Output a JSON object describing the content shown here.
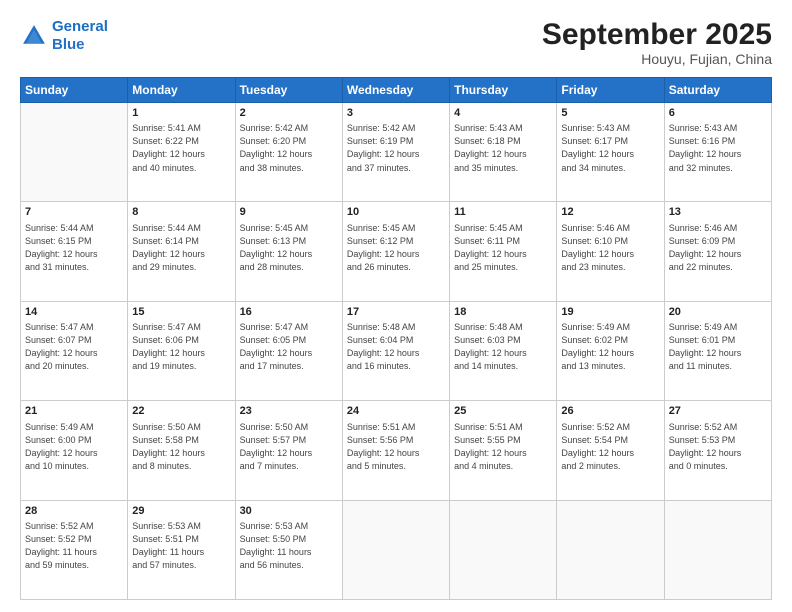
{
  "header": {
    "logo_line1": "General",
    "logo_line2": "Blue",
    "month": "September 2025",
    "location": "Houyu, Fujian, China"
  },
  "weekdays": [
    "Sunday",
    "Monday",
    "Tuesday",
    "Wednesday",
    "Thursday",
    "Friday",
    "Saturday"
  ],
  "weeks": [
    [
      {
        "day": "",
        "info": ""
      },
      {
        "day": "1",
        "info": "Sunrise: 5:41 AM\nSunset: 6:22 PM\nDaylight: 12 hours\nand 40 minutes."
      },
      {
        "day": "2",
        "info": "Sunrise: 5:42 AM\nSunset: 6:20 PM\nDaylight: 12 hours\nand 38 minutes."
      },
      {
        "day": "3",
        "info": "Sunrise: 5:42 AM\nSunset: 6:19 PM\nDaylight: 12 hours\nand 37 minutes."
      },
      {
        "day": "4",
        "info": "Sunrise: 5:43 AM\nSunset: 6:18 PM\nDaylight: 12 hours\nand 35 minutes."
      },
      {
        "day": "5",
        "info": "Sunrise: 5:43 AM\nSunset: 6:17 PM\nDaylight: 12 hours\nand 34 minutes."
      },
      {
        "day": "6",
        "info": "Sunrise: 5:43 AM\nSunset: 6:16 PM\nDaylight: 12 hours\nand 32 minutes."
      }
    ],
    [
      {
        "day": "7",
        "info": "Sunrise: 5:44 AM\nSunset: 6:15 PM\nDaylight: 12 hours\nand 31 minutes."
      },
      {
        "day": "8",
        "info": "Sunrise: 5:44 AM\nSunset: 6:14 PM\nDaylight: 12 hours\nand 29 minutes."
      },
      {
        "day": "9",
        "info": "Sunrise: 5:45 AM\nSunset: 6:13 PM\nDaylight: 12 hours\nand 28 minutes."
      },
      {
        "day": "10",
        "info": "Sunrise: 5:45 AM\nSunset: 6:12 PM\nDaylight: 12 hours\nand 26 minutes."
      },
      {
        "day": "11",
        "info": "Sunrise: 5:45 AM\nSunset: 6:11 PM\nDaylight: 12 hours\nand 25 minutes."
      },
      {
        "day": "12",
        "info": "Sunrise: 5:46 AM\nSunset: 6:10 PM\nDaylight: 12 hours\nand 23 minutes."
      },
      {
        "day": "13",
        "info": "Sunrise: 5:46 AM\nSunset: 6:09 PM\nDaylight: 12 hours\nand 22 minutes."
      }
    ],
    [
      {
        "day": "14",
        "info": "Sunrise: 5:47 AM\nSunset: 6:07 PM\nDaylight: 12 hours\nand 20 minutes."
      },
      {
        "day": "15",
        "info": "Sunrise: 5:47 AM\nSunset: 6:06 PM\nDaylight: 12 hours\nand 19 minutes."
      },
      {
        "day": "16",
        "info": "Sunrise: 5:47 AM\nSunset: 6:05 PM\nDaylight: 12 hours\nand 17 minutes."
      },
      {
        "day": "17",
        "info": "Sunrise: 5:48 AM\nSunset: 6:04 PM\nDaylight: 12 hours\nand 16 minutes."
      },
      {
        "day": "18",
        "info": "Sunrise: 5:48 AM\nSunset: 6:03 PM\nDaylight: 12 hours\nand 14 minutes."
      },
      {
        "day": "19",
        "info": "Sunrise: 5:49 AM\nSunset: 6:02 PM\nDaylight: 12 hours\nand 13 minutes."
      },
      {
        "day": "20",
        "info": "Sunrise: 5:49 AM\nSunset: 6:01 PM\nDaylight: 12 hours\nand 11 minutes."
      }
    ],
    [
      {
        "day": "21",
        "info": "Sunrise: 5:49 AM\nSunset: 6:00 PM\nDaylight: 12 hours\nand 10 minutes."
      },
      {
        "day": "22",
        "info": "Sunrise: 5:50 AM\nSunset: 5:58 PM\nDaylight: 12 hours\nand 8 minutes."
      },
      {
        "day": "23",
        "info": "Sunrise: 5:50 AM\nSunset: 5:57 PM\nDaylight: 12 hours\nand 7 minutes."
      },
      {
        "day": "24",
        "info": "Sunrise: 5:51 AM\nSunset: 5:56 PM\nDaylight: 12 hours\nand 5 minutes."
      },
      {
        "day": "25",
        "info": "Sunrise: 5:51 AM\nSunset: 5:55 PM\nDaylight: 12 hours\nand 4 minutes."
      },
      {
        "day": "26",
        "info": "Sunrise: 5:52 AM\nSunset: 5:54 PM\nDaylight: 12 hours\nand 2 minutes."
      },
      {
        "day": "27",
        "info": "Sunrise: 5:52 AM\nSunset: 5:53 PM\nDaylight: 12 hours\nand 0 minutes."
      }
    ],
    [
      {
        "day": "28",
        "info": "Sunrise: 5:52 AM\nSunset: 5:52 PM\nDaylight: 11 hours\nand 59 minutes."
      },
      {
        "day": "29",
        "info": "Sunrise: 5:53 AM\nSunset: 5:51 PM\nDaylight: 11 hours\nand 57 minutes."
      },
      {
        "day": "30",
        "info": "Sunrise: 5:53 AM\nSunset: 5:50 PM\nDaylight: 11 hours\nand 56 minutes."
      },
      {
        "day": "",
        "info": ""
      },
      {
        "day": "",
        "info": ""
      },
      {
        "day": "",
        "info": ""
      },
      {
        "day": "",
        "info": ""
      }
    ]
  ]
}
